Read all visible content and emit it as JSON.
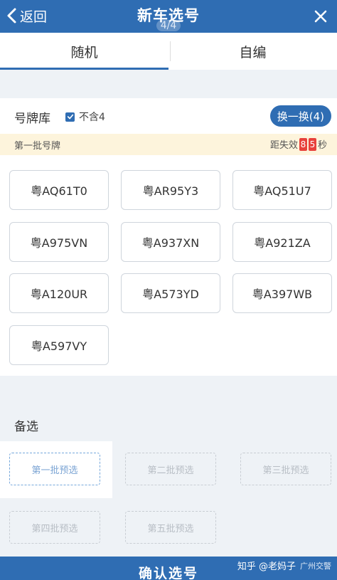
{
  "header": {
    "back_label": "返回",
    "title": "新车选号",
    "page_indicator": "4/4"
  },
  "tabs": [
    {
      "label": "随机",
      "active": true
    },
    {
      "label": "自编",
      "active": false
    }
  ],
  "plate_library": {
    "title": "号牌库",
    "exclude4_label": "不含4",
    "exclude4_checked": true,
    "refresh_label": "换一换(4)",
    "batch_label": "第一批号牌",
    "countdown_prefix": "距失效",
    "countdown_digits": [
      "8",
      "5"
    ],
    "countdown_suffix": "秒",
    "plates": [
      "粤AQ61T0",
      "粤AR95Y3",
      "粤AQ51U7",
      "粤A975VN",
      "粤A937XN",
      "粤A921ZA",
      "粤A120UR",
      "粤A573YD",
      "粤A397WB",
      "粤A597VY"
    ]
  },
  "alternates": {
    "title": "备选",
    "slots": [
      {
        "label": "第一批预选",
        "active": true
      },
      {
        "label": "第二批预选",
        "active": false
      },
      {
        "label": "第三批预选",
        "active": false
      },
      {
        "label": "第四批预选",
        "active": false
      },
      {
        "label": "第五批预选",
        "active": false
      }
    ]
  },
  "confirm_label": "确认选号",
  "watermark": {
    "main": "知乎 @老妈子",
    "sub": "广州交警"
  },
  "colors": {
    "primary": "#2f6db3",
    "countdown_digit": "#e8413b",
    "batch_bar": "#fdf4dc"
  }
}
